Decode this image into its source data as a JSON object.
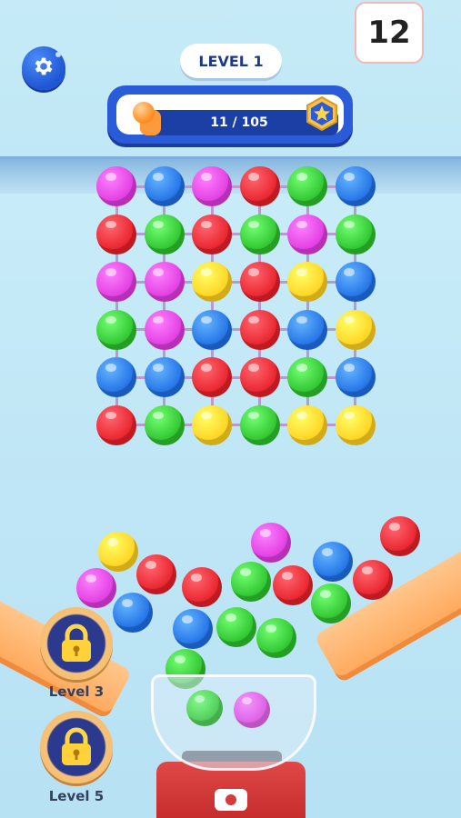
{
  "hud": {
    "level_label": "LEVEL 1",
    "moves_remaining": "12",
    "progress_text": "11 / 105",
    "progress_fraction": 0.105
  },
  "grid": {
    "rows": [
      [
        "magenta",
        "blue",
        "magenta",
        "red",
        "green",
        "blue"
      ],
      [
        "red",
        "green",
        "red",
        "green",
        "magenta",
        "green"
      ],
      [
        "magenta",
        "magenta",
        "yellow",
        "red",
        "yellow",
        "blue"
      ],
      [
        "green",
        "magenta",
        "blue",
        "red",
        "blue",
        "yellow"
      ],
      [
        "blue",
        "blue",
        "red",
        "red",
        "green",
        "blue"
      ],
      [
        "red",
        "green",
        "yellow",
        "green",
        "yellow",
        "yellow"
      ]
    ]
  },
  "colors": {
    "red": "#e8202a",
    "blue": "#1f6fe6",
    "green": "#2cc22c",
    "magenta": "#e03ae0",
    "yellow": "#ffd11f"
  },
  "locked_levels": [
    {
      "label": "Level 3",
      "icon": "padlock-icon"
    },
    {
      "label": "Level 5",
      "icon": "padlock-icon"
    }
  ],
  "icons": {
    "settings": "gear-icon",
    "badge": "star-icon"
  }
}
